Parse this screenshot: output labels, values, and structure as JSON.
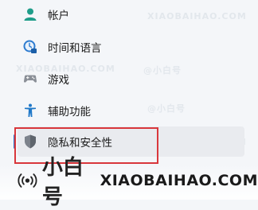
{
  "nav": {
    "items": [
      {
        "label": "帐户",
        "icon": "account-icon"
      },
      {
        "label": "时间和语言",
        "icon": "time-language-icon"
      },
      {
        "label": "游戏",
        "icon": "gaming-icon"
      },
      {
        "label": "辅助功能",
        "icon": "accessibility-icon"
      },
      {
        "label": "隐私和安全性",
        "icon": "privacy-shield-icon",
        "selected": true
      }
    ]
  },
  "watermark": {
    "name": "小白号",
    "site": "XIAOBAIHAO.COM",
    "faint_site": "XIAOBAIHAO.COM",
    "faint_name": "@小白号"
  },
  "colors": {
    "accent": "#2e74c9",
    "highlight": "#d9373c",
    "background": "#f4f6f9"
  }
}
